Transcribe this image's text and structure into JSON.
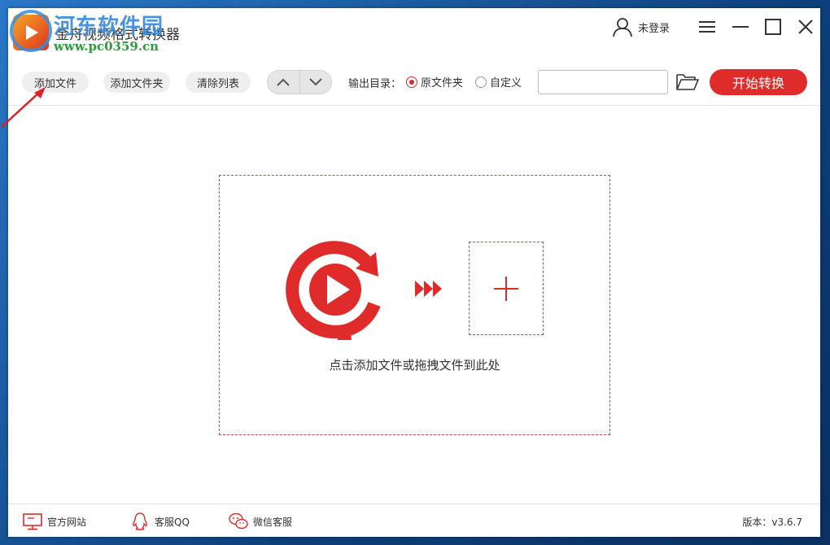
{
  "window": {
    "title": "金舟视频格式转换器",
    "watermark_title": "河东软件园",
    "watermark_url": "www.pc0359.cn"
  },
  "header": {
    "user_label": "未登录"
  },
  "toolbar": {
    "add_file": "添加文件",
    "add_folder": "添加文件夹",
    "clear_list": "清除列表",
    "output_label": "输出目录：",
    "radio_original": "原文件夹",
    "radio_custom": "自定义",
    "radio_selected": "原文件夹",
    "path_value": "",
    "start_button": "开始转换"
  },
  "drop_area": {
    "hint": "点击添加文件或拖拽文件到此处"
  },
  "statusbar": {
    "website": "官方网站",
    "qq_support": "客服QQ",
    "wechat_support": "微信客服",
    "version": "版本：v3.6.7"
  },
  "colors": {
    "accent": "#e02b2b",
    "dashed_border": "#c94747",
    "desktop": "#1b5fa8"
  },
  "icons": [
    "user-icon",
    "menu-icon",
    "minimize-icon",
    "maximize-icon",
    "close-icon",
    "chevron-up-icon",
    "chevron-down-icon",
    "folder-open-icon",
    "video-convert-icon",
    "triple-arrow-icon",
    "plus-icon",
    "monitor-icon",
    "qq-icon",
    "wechat-icon"
  ]
}
